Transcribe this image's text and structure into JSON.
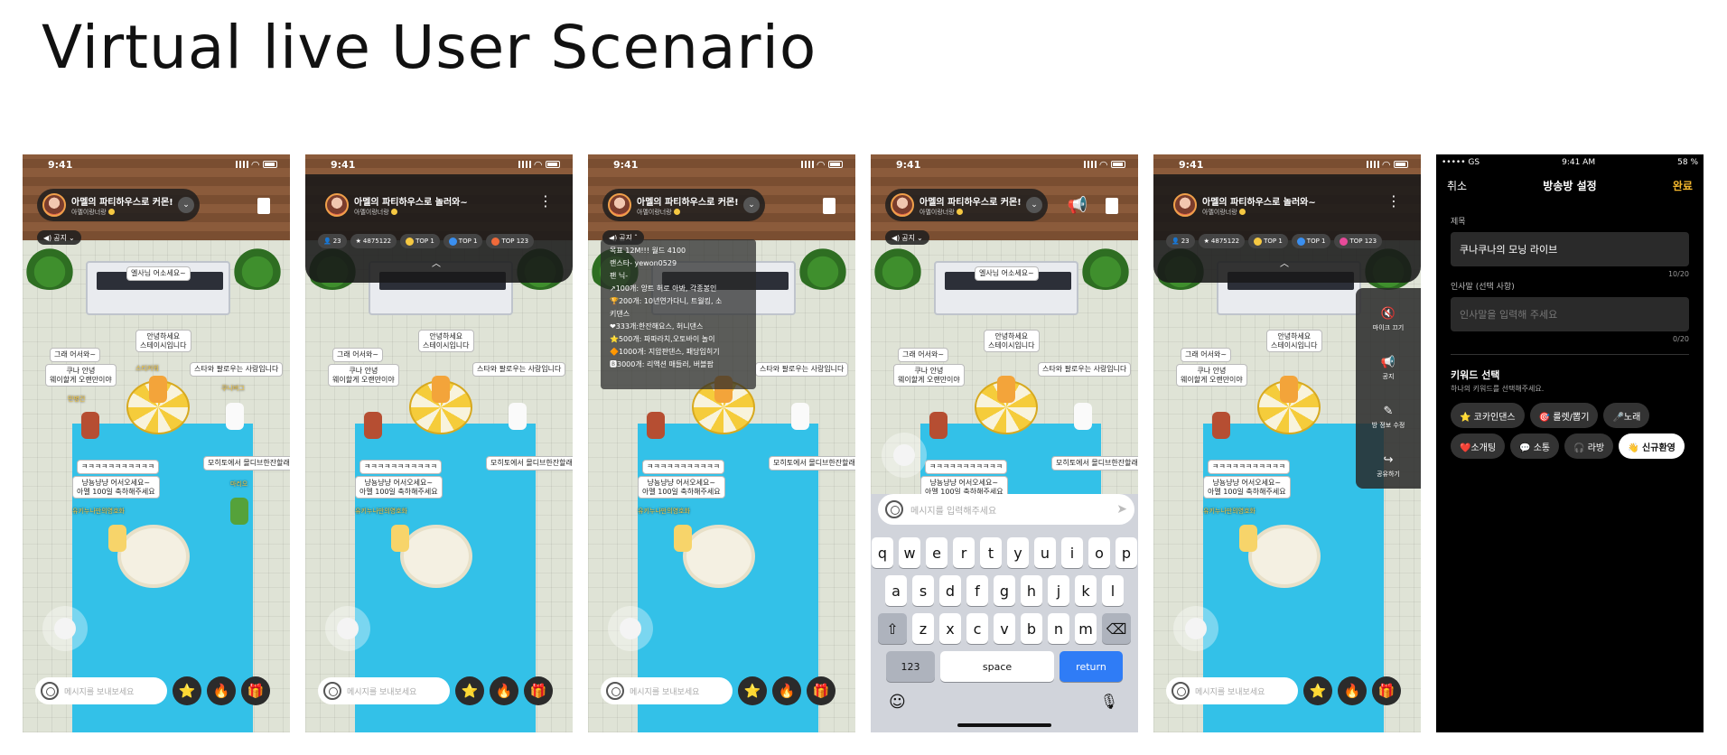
{
  "page_title": "Virtual live User Scenario",
  "status_time": "9:41",
  "room": {
    "title_collapsed": "아멜의 파티하우스로 커몬!",
    "title_expanded": "아멜의 파티하우스로 놀러와~",
    "host": "아멜이랑너랑",
    "notice_label": "공지",
    "stats": {
      "viewers": "23",
      "stars": "4875122",
      "top1a": "TOP 1",
      "top1b": "TOP 1",
      "top123": "TOP 123"
    }
  },
  "scene_bubbles": {
    "b1": "엘사님 어소세요~",
    "b2": "안녕하세요\n스테이시입니다",
    "b3": "그래 어서와~",
    "b4": "쿠나 안녕\n웨이할게 오랜만이야",
    "b5": "스타와 팔로우는 사랑입니다",
    "b6": "ㅋㅋㅋㅋㅋㅋㅋㅋㅋㅋㅋ",
    "b7": "모히토에서 몰디브한잔할래?",
    "b8": "냥뇽냥냥 어서오세요~\n아멜 100일 축하해주세요",
    "n1": "유키누나만의영호화",
    "n2": "스티커워",
    "n3": "쿠니버그",
    "n4": "민병건",
    "n5": "마리오",
    "n6": "코버드하"
  },
  "notice_list": [
    "목표 12M!!! 월드 4100",
    "랜스타- yewon0529",
    "팬 닉-",
    "↗100개: 앙트 허로 아봐, 각종봉인",
    "🏆200개: 10년연가다니, 트월킹, 소",
    "키댄스",
    "❤333개:한잔해요스, 허니댄스 ",
    "⭐500개: 파파라치,오토바이 놀이",
    "🔶1000개: 지압판댄스, 패당입히기",
    "🅱3000개: 리액션 매들러, 버블팝"
  ],
  "message_placeholder": "메시지를 보내보세요",
  "input_placeholder_kb": "메시지를 입력해주세요",
  "keyboard": {
    "row1": [
      "q",
      "w",
      "e",
      "r",
      "t",
      "y",
      "u",
      "i",
      "o",
      "p"
    ],
    "row2": [
      "a",
      "s",
      "d",
      "f",
      "g",
      "h",
      "j",
      "k",
      "l"
    ],
    "row3": [
      "z",
      "x",
      "c",
      "v",
      "b",
      "n",
      "m"
    ],
    "num": "123",
    "space": "space",
    "return": "return"
  },
  "side_menu": {
    "mic_off": "마이크 끄기",
    "notice": "공지",
    "edit_info": "방 정보 수정",
    "share": "공유하기"
  },
  "settings": {
    "carrier": "••••• GS",
    "time": "9:41 AM",
    "battery": "58 %",
    "cancel": "취소",
    "title": "방송방 설정",
    "done": "완료",
    "title_label": "제목",
    "title_value": "쿠나쿠나의 모닝 라이브",
    "title_count": "10/20",
    "greeting_label": "인사말 (선택 사항)",
    "greeting_placeholder": "인사말을 입력해 주세요",
    "greeting_count": "0/20",
    "keyword_title": "키워드 선택",
    "keyword_sub": "하나의 키워드를 선택해주세요.",
    "chips": [
      "⭐ 코카인댄스",
      "🎯 룰렛/뽑기",
      "🎤노래",
      "❤️소개팅",
      "💬 소통",
      "🎧 라방",
      "👋 신규환영"
    ]
  },
  "colors": {
    "accent": "#f5b82e",
    "return_key": "#2f7cf6",
    "pool": "#33c1e8"
  }
}
